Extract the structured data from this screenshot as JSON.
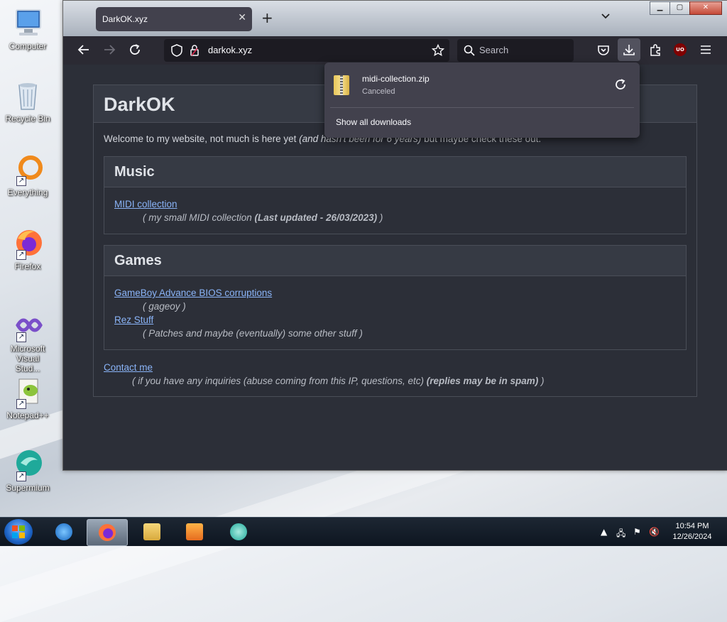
{
  "desktop": {
    "icons": [
      {
        "label": "Computer"
      },
      {
        "label": "Recycle Bin"
      },
      {
        "label": "Everything"
      },
      {
        "label": "Firefox"
      },
      {
        "label": "Microsoft Visual Stud..."
      },
      {
        "label": "Notepad++"
      },
      {
        "label": "Supermium"
      }
    ]
  },
  "browser": {
    "tab_title": "DarkOK.xyz",
    "url": "darkok.xyz",
    "search_placeholder": "Search",
    "ublock_badge": "UO"
  },
  "page": {
    "site_title": "DarkOK",
    "welcome_text": "Welcome to my website, not much is here yet",
    "welcome_italic": "(and hasn't been for 6 years)",
    "welcome_tail": "but maybe check these out.",
    "sections": [
      {
        "title": "Music",
        "entries": [
          {
            "link": "MIDI collection",
            "note_open": "( my small MIDI collection ",
            "note_bold": "(Last updated - 26/03/2023)",
            "note_close": " )"
          }
        ]
      },
      {
        "title": "Games",
        "entries": [
          {
            "link": "GameBoy Advance BIOS corruptions",
            "note": "( gageoy )"
          },
          {
            "link": "Rez Stuff",
            "note": "( Patches and maybe (eventually) some other stuff )"
          }
        ]
      }
    ],
    "contact_link": "Contact me",
    "contact_note_open": "( if you have any inquiries (abuse coming from this IP, questions, etc) ",
    "contact_note_bold": "(replies may be in spam)",
    "contact_note_close": " )"
  },
  "downloads_panel": {
    "file_name": "midi-collection.zip",
    "status": "Canceled",
    "show_all": "Show all downloads"
  },
  "taskbar": {
    "time": "10:54 PM",
    "date": "12/26/2024"
  },
  "colors": {
    "page_bg": "#2c2f38",
    "link": "#8ab4f8",
    "toolbar": "#2b2a33",
    "panel": "#42414d"
  }
}
